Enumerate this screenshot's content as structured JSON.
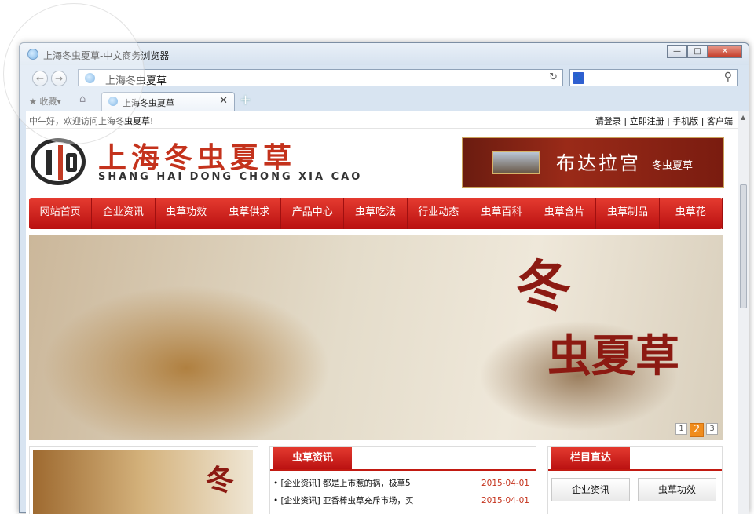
{
  "window": {
    "title": "上海冬虫夏草-中文商务浏览器"
  },
  "address": {
    "url": "上海冬虫夏草"
  },
  "tabs": {
    "fav_label": "收藏▾",
    "active_tab": "上海冬虫夏草",
    "new_tab": "+"
  },
  "site": {
    "welcome": "中午好，欢迎访问上海冬虫夏草!",
    "top_links": "请登录 | 立即注册 | 手机版 | 客户端",
    "brand_cn": "上海冬虫夏草",
    "brand_en": "SHANG HAI DONG CHONG XIA CAO",
    "ad_main": "布达拉宫",
    "ad_sub": "冬虫夏草",
    "menu": [
      "网站首页",
      "企业资讯",
      "虫草功效",
      "虫草供求",
      "产品中心",
      "虫草吃法",
      "行业动态",
      "虫草百科",
      "虫草含片",
      "虫草制品",
      "虫草花"
    ],
    "banner_cal1": "冬",
    "banner_cal2": "虫夏草",
    "slides": [
      "1",
      "2",
      "3"
    ],
    "left_cal": "冬",
    "news_title": "虫草资讯",
    "news": [
      {
        "text": "• [企业资讯] 都是上市惹的祸，极草5",
        "date": "2015-04-01"
      },
      {
        "text": "• [企业资讯] 亚香棒虫草充斥市场，买",
        "date": "2015-04-01"
      }
    ],
    "cat_title": "栏目直达",
    "cat_buttons": [
      "企业资讯",
      "虫草功效"
    ]
  }
}
